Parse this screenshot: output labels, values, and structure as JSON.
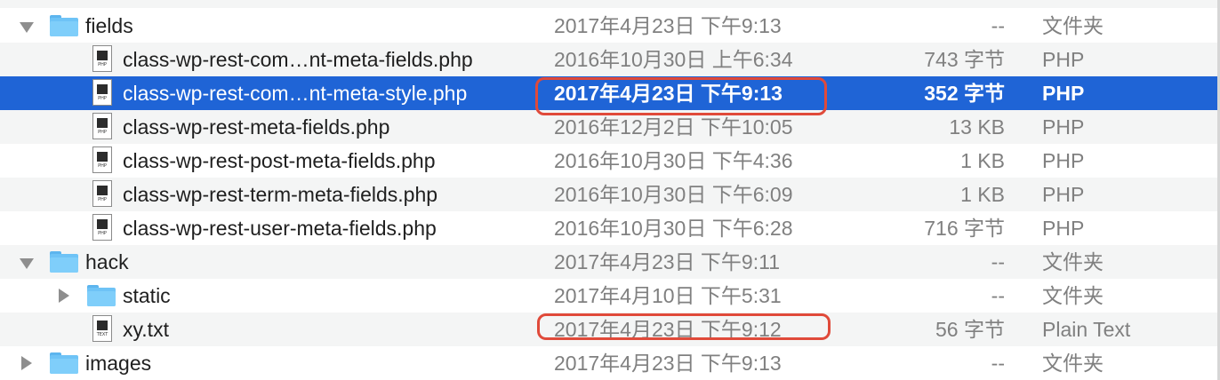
{
  "colors": {
    "selection": "#1f64d6",
    "stripe": "#f4f5f5",
    "secondary_text": "#808080",
    "annotation": "#e04a3a",
    "folder": "#6ec3f6"
  },
  "rows": [
    {
      "name": "fields",
      "date": "2017年4月23日 下午9:13",
      "size": "--",
      "kind": "文件夹",
      "icon": "folder-icon",
      "disclosure": "expanded"
    },
    {
      "name": "class-wp-rest-com…nt-meta-fields.php",
      "date": "2016年10月30日 上午6:34",
      "size": "743 字节",
      "kind": "PHP",
      "icon": "php-file-icon"
    },
    {
      "name": "class-wp-rest-com…nt-meta-style.php",
      "date": "2017年4月23日 下午9:13",
      "size": "352 字节",
      "kind": "PHP",
      "icon": "php-file-icon",
      "selected": true
    },
    {
      "name": "class-wp-rest-meta-fields.php",
      "date": "2016年12月2日 下午10:05",
      "size": "13 KB",
      "kind": "PHP",
      "icon": "php-file-icon"
    },
    {
      "name": "class-wp-rest-post-meta-fields.php",
      "date": "2016年10月30日 下午4:36",
      "size": "1 KB",
      "kind": "PHP",
      "icon": "php-file-icon"
    },
    {
      "name": "class-wp-rest-term-meta-fields.php",
      "date": "2016年10月30日 下午6:09",
      "size": "1 KB",
      "kind": "PHP",
      "icon": "php-file-icon"
    },
    {
      "name": "class-wp-rest-user-meta-fields.php",
      "date": "2016年10月30日 下午6:28",
      "size": "716 字节",
      "kind": "PHP",
      "icon": "php-file-icon"
    },
    {
      "name": "hack",
      "date": "2017年4月23日 下午9:11",
      "size": "--",
      "kind": "文件夹",
      "icon": "folder-icon",
      "disclosure": "expanded"
    },
    {
      "name": "static",
      "date": "2017年4月10日 下午5:31",
      "size": "--",
      "kind": "文件夹",
      "icon": "folder-icon",
      "disclosure": "collapsed"
    },
    {
      "name": "xy.txt",
      "date": "2017年4月23日 下午9:12",
      "size": "56 字节",
      "kind": "Plain Text",
      "icon": "text-file-icon"
    },
    {
      "name": "images",
      "date": "2017年4月23日 下午9:13",
      "size": "--",
      "kind": "文件夹",
      "icon": "folder-icon",
      "disclosure": "collapsed"
    }
  ],
  "file_badges": {
    "php": "PHP",
    "txt": "TEXT"
  }
}
